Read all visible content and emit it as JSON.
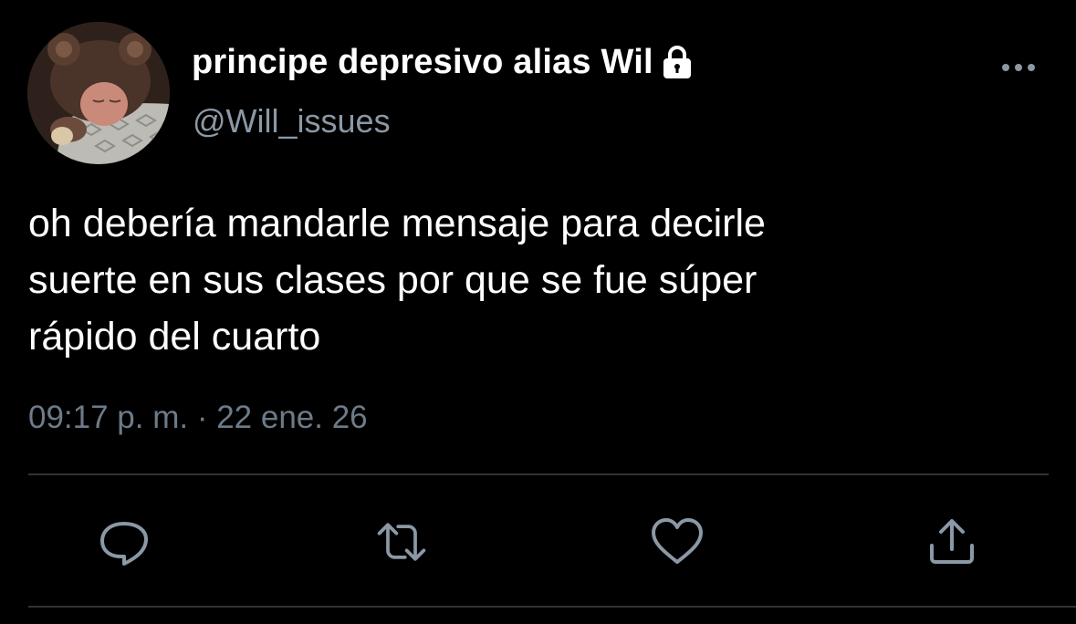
{
  "user": {
    "display_name": "principe depresivo alias Wil",
    "handle": "@Will_issues",
    "protected_icon": "lock-icon",
    "avatar": "profile-photo"
  },
  "tweet": {
    "text": "oh debería mandarle mensaje para decirle\nsuerte en sus clases por que se fue súper\nrápido del cuarto",
    "timestamp": "09:17 p. m. · 22 ene. 26"
  },
  "actions": [
    {
      "name": "reply",
      "icon": "reply-icon"
    },
    {
      "name": "retweet",
      "icon": "retweet-icon"
    },
    {
      "name": "like",
      "icon": "heart-icon"
    },
    {
      "name": "share",
      "icon": "share-icon"
    }
  ],
  "menu_icon": "more-options-icon",
  "colors": {
    "background": "#000000",
    "primary_text": "#ffffff",
    "secondary_text": "#8b98a5",
    "icon": "#8b98a5",
    "divider": "#2f3336"
  }
}
